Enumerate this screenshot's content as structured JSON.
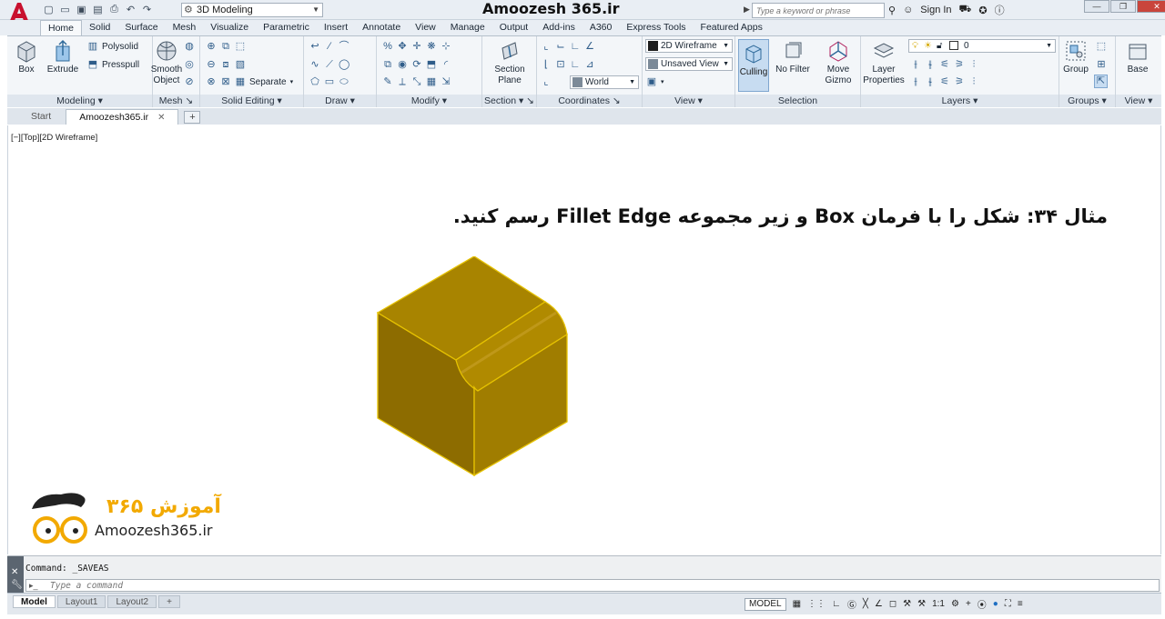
{
  "window": {
    "title": "Amoozesh 365.ir",
    "workspace": "3D Modeling",
    "search_placeholder": "Type a keyword or phrase",
    "sign_in": "Sign In"
  },
  "ribbon_tabs": [
    "Home",
    "Solid",
    "Surface",
    "Mesh",
    "Visualize",
    "Parametric",
    "Insert",
    "Annotate",
    "View",
    "Manage",
    "Output",
    "Add-ins",
    "A360",
    "Express Tools",
    "Featured Apps"
  ],
  "panels": {
    "modeling": {
      "title": "Modeling",
      "box": "Box",
      "extrude": "Extrude",
      "polysolid": "Polysolid",
      "presspull": "Presspull"
    },
    "mesh": {
      "title": "Mesh",
      "smooth_object_1": "Smooth",
      "smooth_object_2": "Object"
    },
    "solid_editing": {
      "title": "Solid Editing",
      "separate": "Separate"
    },
    "draw": {
      "title": "Draw"
    },
    "modify": {
      "title": "Modify"
    },
    "section": {
      "title": "Section",
      "section_plane_1": "Section",
      "section_plane_2": "Plane"
    },
    "coordinates": {
      "title": "Coordinates",
      "world": "World"
    },
    "view": {
      "title": "View",
      "visual_style": "2D Wireframe",
      "named_view": "Unsaved View"
    },
    "selection": {
      "title": "Selection",
      "culling": "Culling",
      "no_filter": "No Filter",
      "move_gizmo_1": "Move",
      "move_gizmo_2": "Gizmo"
    },
    "layers": {
      "title": "Layers",
      "layer_properties_1": "Layer",
      "layer_properties_2": "Properties",
      "current_layer": "0"
    },
    "groups": {
      "title": "Groups",
      "group": "Group"
    },
    "view2": {
      "title": "View",
      "base": "Base"
    }
  },
  "file_tabs": [
    {
      "label": "Start"
    },
    {
      "label": "Amoozesh365.ir"
    }
  ],
  "viewport": {
    "label": "[−][Top][2D Wireframe]",
    "headline": "مثال ۳۴: شکل را با فرمان  Box و زیر مجموعه Fillet Edge رسم کنید.",
    "brand_url": "Amoozesh365.ir",
    "brand_logo_text": "آموزش ۳۶۵",
    "colors": {
      "cube_top": "#a88400",
      "cube_left": "#8d6c00",
      "cube_right": "#a07d00",
      "cube_edge": "#e6c200"
    }
  },
  "command": {
    "history": "Command:  _SAVEAS",
    "placeholder": "Type a command"
  },
  "status": {
    "layout_tabs": [
      "Model",
      "Layout1",
      "Layout2"
    ],
    "model": "MODEL",
    "scale": "1:1"
  }
}
